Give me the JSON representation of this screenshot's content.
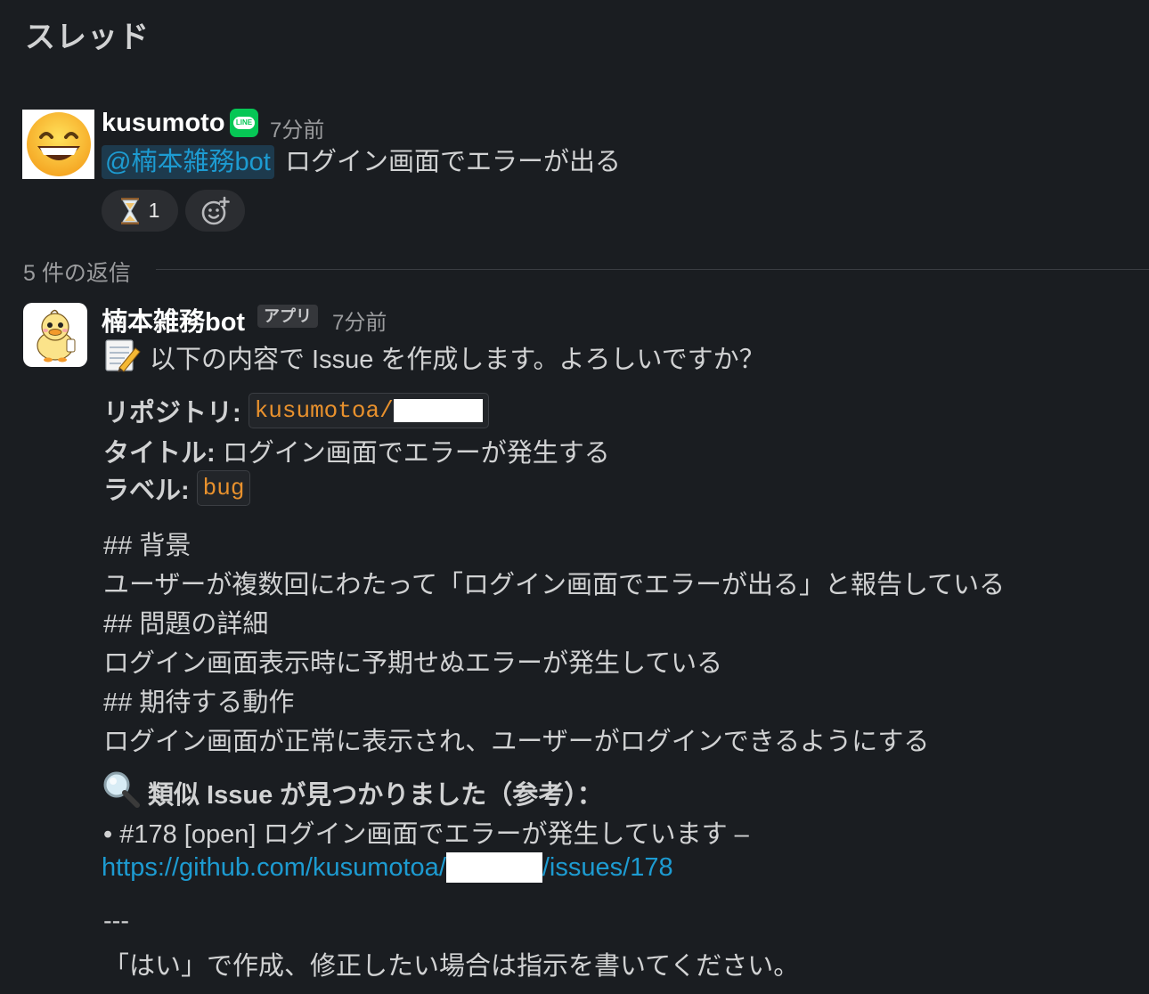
{
  "thread": {
    "title": "スレッド"
  },
  "message1": {
    "username": "kusumoto",
    "badge_text": "LINE",
    "timestamp": "7分前",
    "mention": "@楠本雑務bot",
    "text": "ログイン画面でエラーが出る",
    "reaction": {
      "emoji": "hourglass-icon",
      "count": "1"
    }
  },
  "replies": {
    "label": "5 件の返信"
  },
  "message2": {
    "username": "楠本雑務bot",
    "app_badge": "アプリ",
    "timestamp": "7分前",
    "intro": "以下の内容で Issue を作成します。よろしいですか？",
    "repo_label": "リポジトリ:",
    "repo_value": "kusumotoa/",
    "title_label": "タイトル:",
    "title_value": "ログイン画面でエラーが発生する",
    "label_label": "ラベル:",
    "label_value": "bug",
    "body_lines": [
      "## 背景",
      "ユーザーが複数回にわたって「ログイン画面でエラーが出る」と報告している",
      "## 問題の詳細",
      "ログイン画面表示時に予期せぬエラーが発生している",
      "## 期待する動作",
      "ログイン画面が正常に表示され、ユーザーがログインできるようにする"
    ],
    "similar_heading": "類似 Issue が見つかりました（参考）：",
    "similar_item": "• #178 [open] ログイン画面でエラーが発生しています –",
    "similar_link_prefix": "https://github.com/kusumotoa/",
    "similar_link_suffix": "/issues/178",
    "separator": "---",
    "footer": "「はい」で作成、修正したい場合は指示を書いてください。"
  },
  "colors": {
    "background": "#1a1d21",
    "text": "#d1d2d3",
    "link": "#1d9bd1",
    "code": "#e8912d",
    "line_green": "#06c755"
  }
}
